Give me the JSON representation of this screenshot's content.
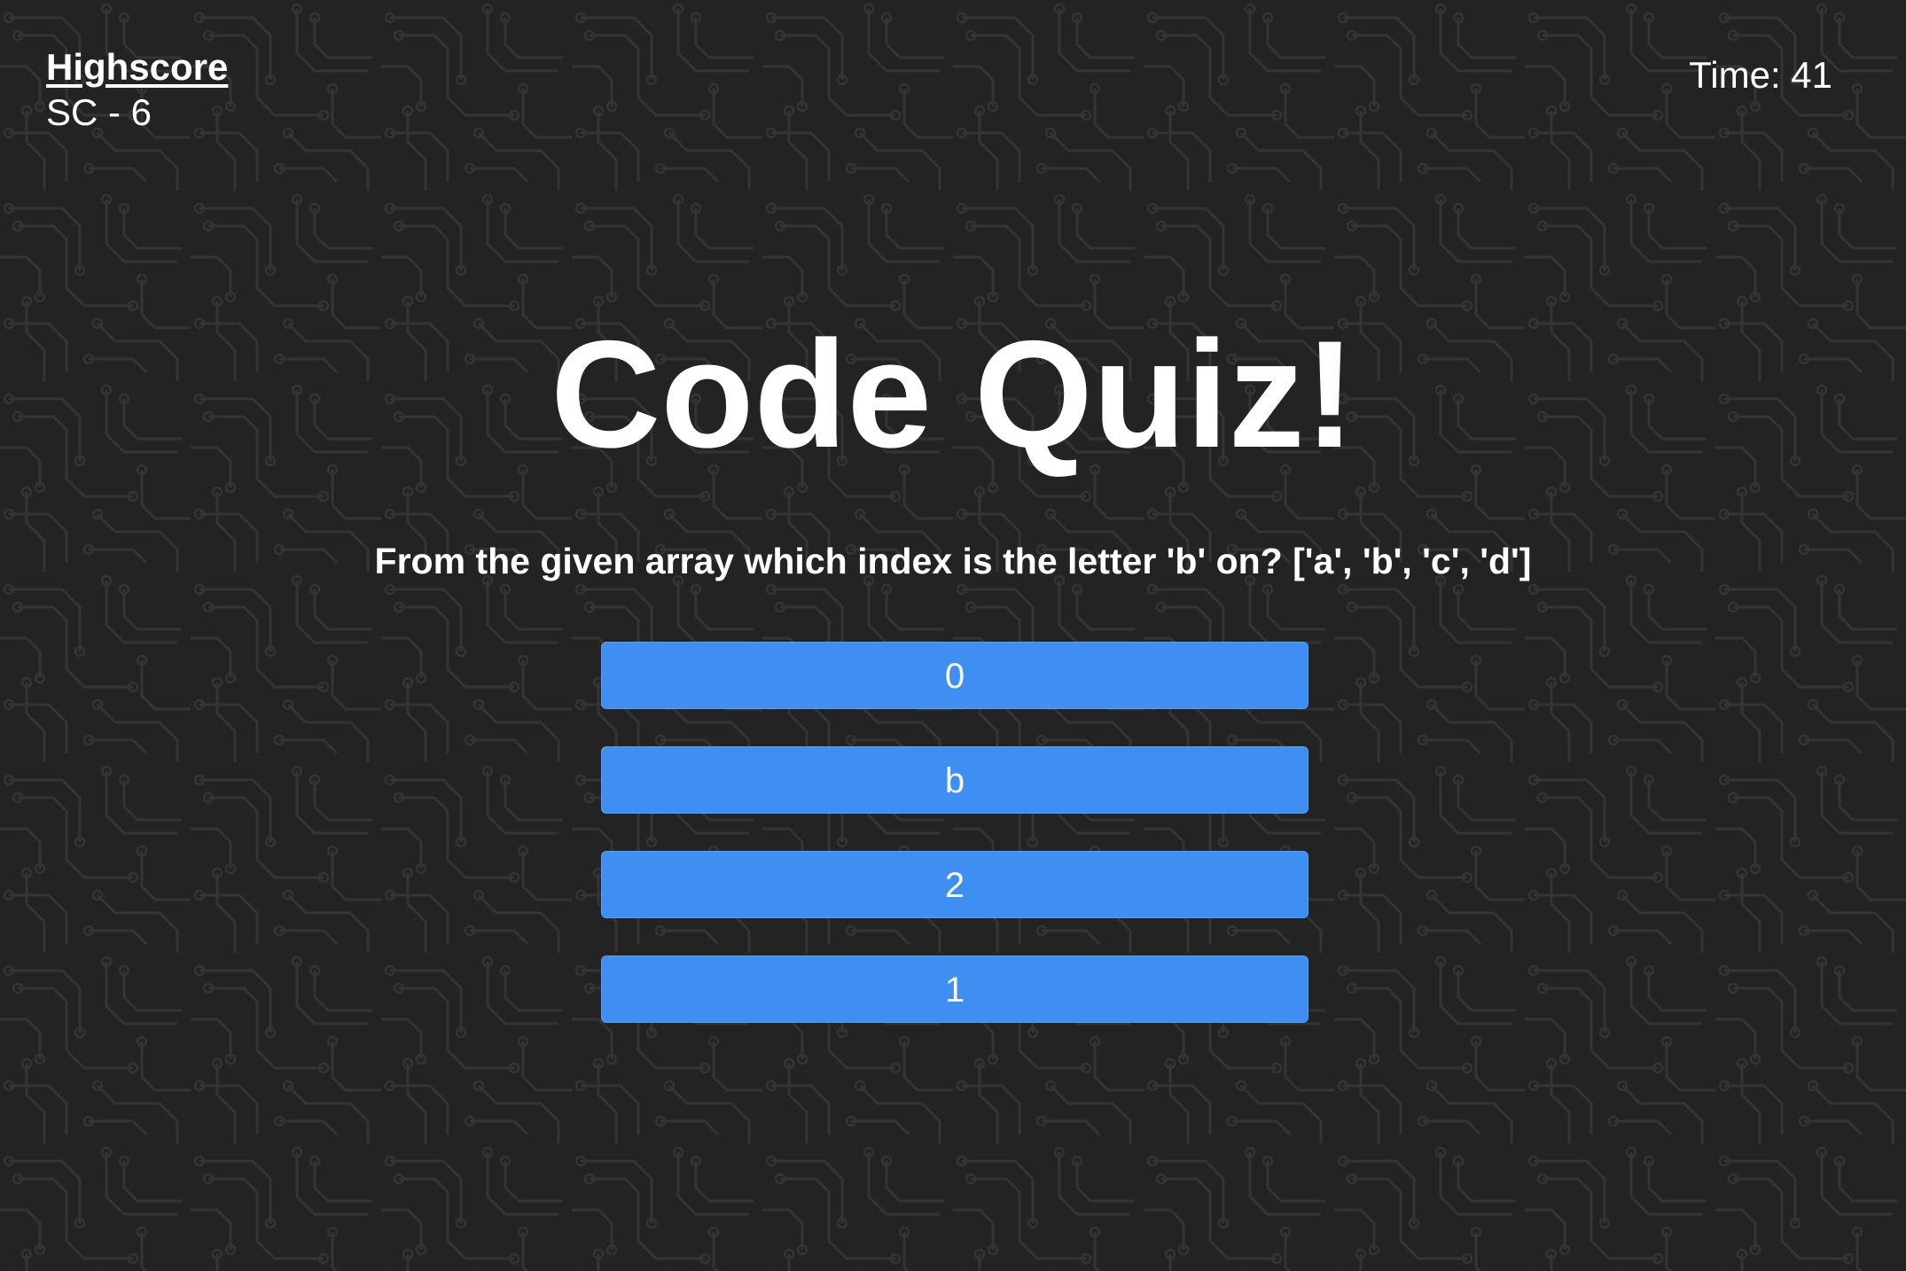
{
  "header": {
    "highscore_label": "Highscore",
    "highscore_value": "SC - 6",
    "timer_text": "Time: 41"
  },
  "quiz": {
    "title": "Code Quiz!",
    "question": "From the given array which index is the letter 'b' on? ['a', 'b', 'c', 'd']",
    "answers": [
      "0",
      "b",
      "2",
      "1"
    ]
  },
  "colors": {
    "background": "#232323",
    "circuit_lines": "#2f2f2f",
    "button": "#3f8ff3",
    "text": "#ffffff"
  },
  "background_pattern": "circuit-board"
}
